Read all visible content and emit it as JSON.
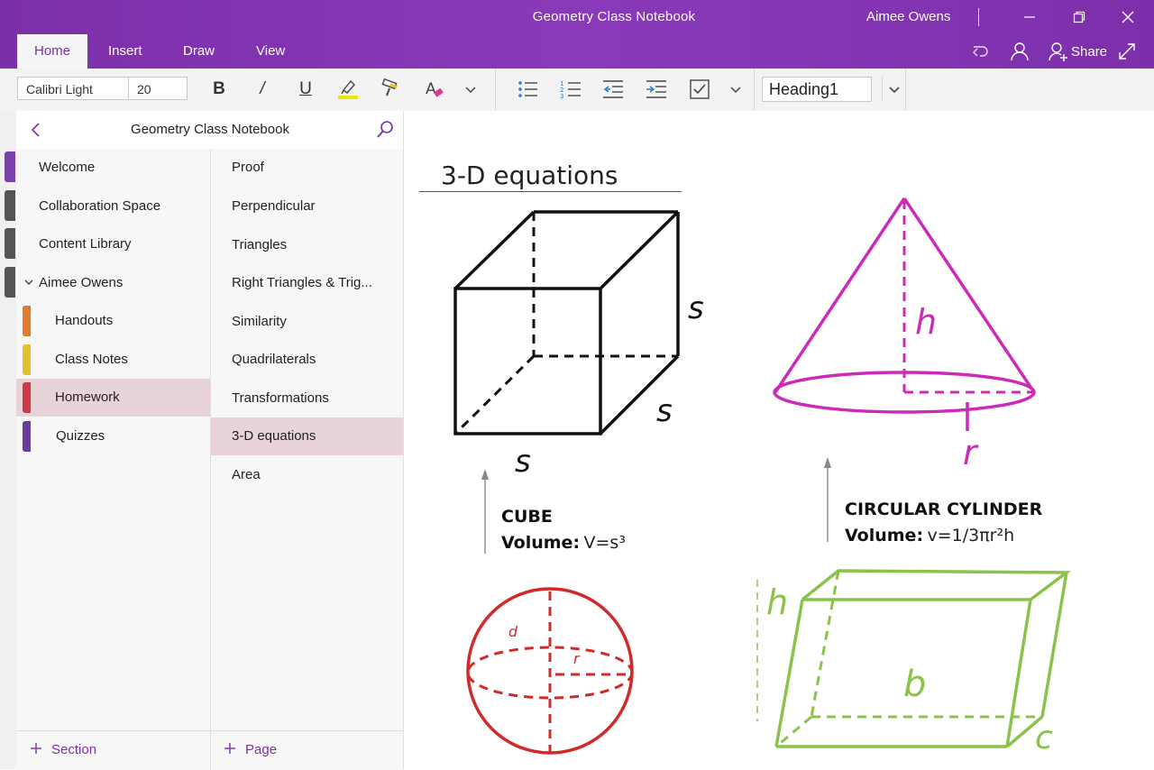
{
  "app": {
    "window_title": "Geometry Class Notebook",
    "user_name": "Aimee Owens"
  },
  "tabs": [
    {
      "label": "Home",
      "active": true
    },
    {
      "label": "Insert",
      "active": false
    },
    {
      "label": "Draw",
      "active": false
    },
    {
      "label": "View",
      "active": false
    }
  ],
  "toolbar": {
    "share_label": "Share",
    "font_name": "Calibri Light",
    "font_size": "20",
    "bold_glyph": "B",
    "italic_glyph": "/",
    "underline_glyph": "U",
    "style_value": "Heading1",
    "highlight_color": "#f2e500"
  },
  "navigation": {
    "notebook_title": "Geometry Class Notebook",
    "sections": [
      {
        "label": "Welcome",
        "type": "section-group"
      },
      {
        "label": "Collaboration Space",
        "type": "section-group"
      },
      {
        "label": "Content Library",
        "type": "section-group"
      },
      {
        "label": "Aimee Owens",
        "type": "group-expanded"
      },
      {
        "label": "Handouts",
        "color": "#e07a2e"
      },
      {
        "label": "Class Notes",
        "color": "#e0c02b"
      },
      {
        "label": "Homework",
        "color": "#d13a44",
        "selected": true
      },
      {
        "label": "Quizzes",
        "color": "#6a3aa0"
      }
    ],
    "pages": [
      {
        "label": "Proof"
      },
      {
        "label": "Perpendicular"
      },
      {
        "label": "Triangles"
      },
      {
        "label": "Right Triangles & Trig..."
      },
      {
        "label": "Similarity"
      },
      {
        "label": "Quadrilaterals"
      },
      {
        "label": "Transformations"
      },
      {
        "label": "3-D equations",
        "selected": true
      },
      {
        "label": "Area"
      }
    ],
    "add_section_label": "Section",
    "add_page_label": "Page"
  },
  "page": {
    "title": "3-D equations",
    "cube": {
      "name": "CUBE",
      "volume_label": "Volume:",
      "formula": "V=s³",
      "side_label": "s",
      "color": "#111111"
    },
    "cone": {
      "name": "CIRCULAR CYLINDER",
      "volume_label": "Volume:",
      "formula": "v=1/3πr²h",
      "height_label": "h",
      "radius_label": "r",
      "color": "#cc2bb8"
    },
    "sphere": {
      "diameter_label": "d",
      "radius_label": "r",
      "color": "#d02a2a"
    },
    "prism": {
      "height_label": "h",
      "base_label": "b",
      "depth_label": "c",
      "color": "#8bc34a"
    }
  },
  "colors": {
    "brand": "#7b2fa8",
    "selection": "#e8d3d8"
  }
}
